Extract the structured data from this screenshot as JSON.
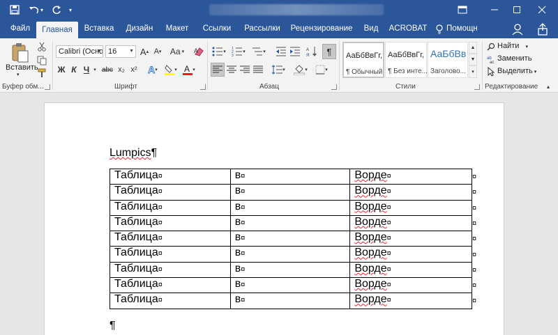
{
  "titlebar": {
    "save_icon": "save-icon",
    "undo_icon": "undo-icon",
    "redo_icon": "redo-icon",
    "window_controls": [
      "restore-ribbon-icon",
      "minimize-icon",
      "maximize-icon",
      "close-icon"
    ]
  },
  "tabs": [
    "Файл",
    "Главная",
    "Вставка",
    "Дизайн",
    "Макет",
    "Ссылки",
    "Рассылки",
    "Рецензирование",
    "Вид",
    "ACROBAT",
    "Помощн"
  ],
  "active_tab": "Главная",
  "ribbon": {
    "clipboard": {
      "paste_label": "Вставить",
      "group_label": "Буфер обм..."
    },
    "font": {
      "font_name": "Calibri (Осно",
      "font_size": "16",
      "bold": "Ж",
      "italic": "К",
      "underline": "Ч",
      "strike": "abc",
      "sub": "x₂",
      "sup": "x²",
      "case": "Aa",
      "group_label": "Шрифт"
    },
    "paragraph": {
      "group_label": "Абзац"
    },
    "styles": {
      "items": [
        {
          "sample": "АаБбВвГг,",
          "name": "¶ Обычный"
        },
        {
          "sample": "АаБбВвГг,",
          "name": "¶ Без инте..."
        },
        {
          "sample": "АаБбВв",
          "name": "Заголово..."
        }
      ],
      "group_label": "Стили"
    },
    "editing": {
      "find": "Найти",
      "replace": "Заменить",
      "select": "Выделить",
      "group_label": "Редактирование"
    }
  },
  "document": {
    "title_text": "Lumpics",
    "pilcrow": "¶",
    "cell_mark": "¤",
    "rows": [
      [
        "Таблица",
        "в",
        "Ворде"
      ],
      [
        "Таблица",
        "в",
        "Ворде"
      ],
      [
        "Таблица",
        "в",
        "Ворде"
      ],
      [
        "Таблица",
        "в",
        "Ворде"
      ],
      [
        "Таблица",
        "в",
        "Ворде"
      ],
      [
        "Таблица",
        "в",
        "Ворде"
      ],
      [
        "Таблица",
        "в",
        "Ворде"
      ],
      [
        "Таблица",
        "в",
        "Ворде"
      ],
      [
        "Таблица",
        "в",
        "Ворде"
      ]
    ]
  },
  "colors": {
    "accent": "#2b579a",
    "ribbon": "#f3f3f3",
    "spell": "#e23"
  }
}
